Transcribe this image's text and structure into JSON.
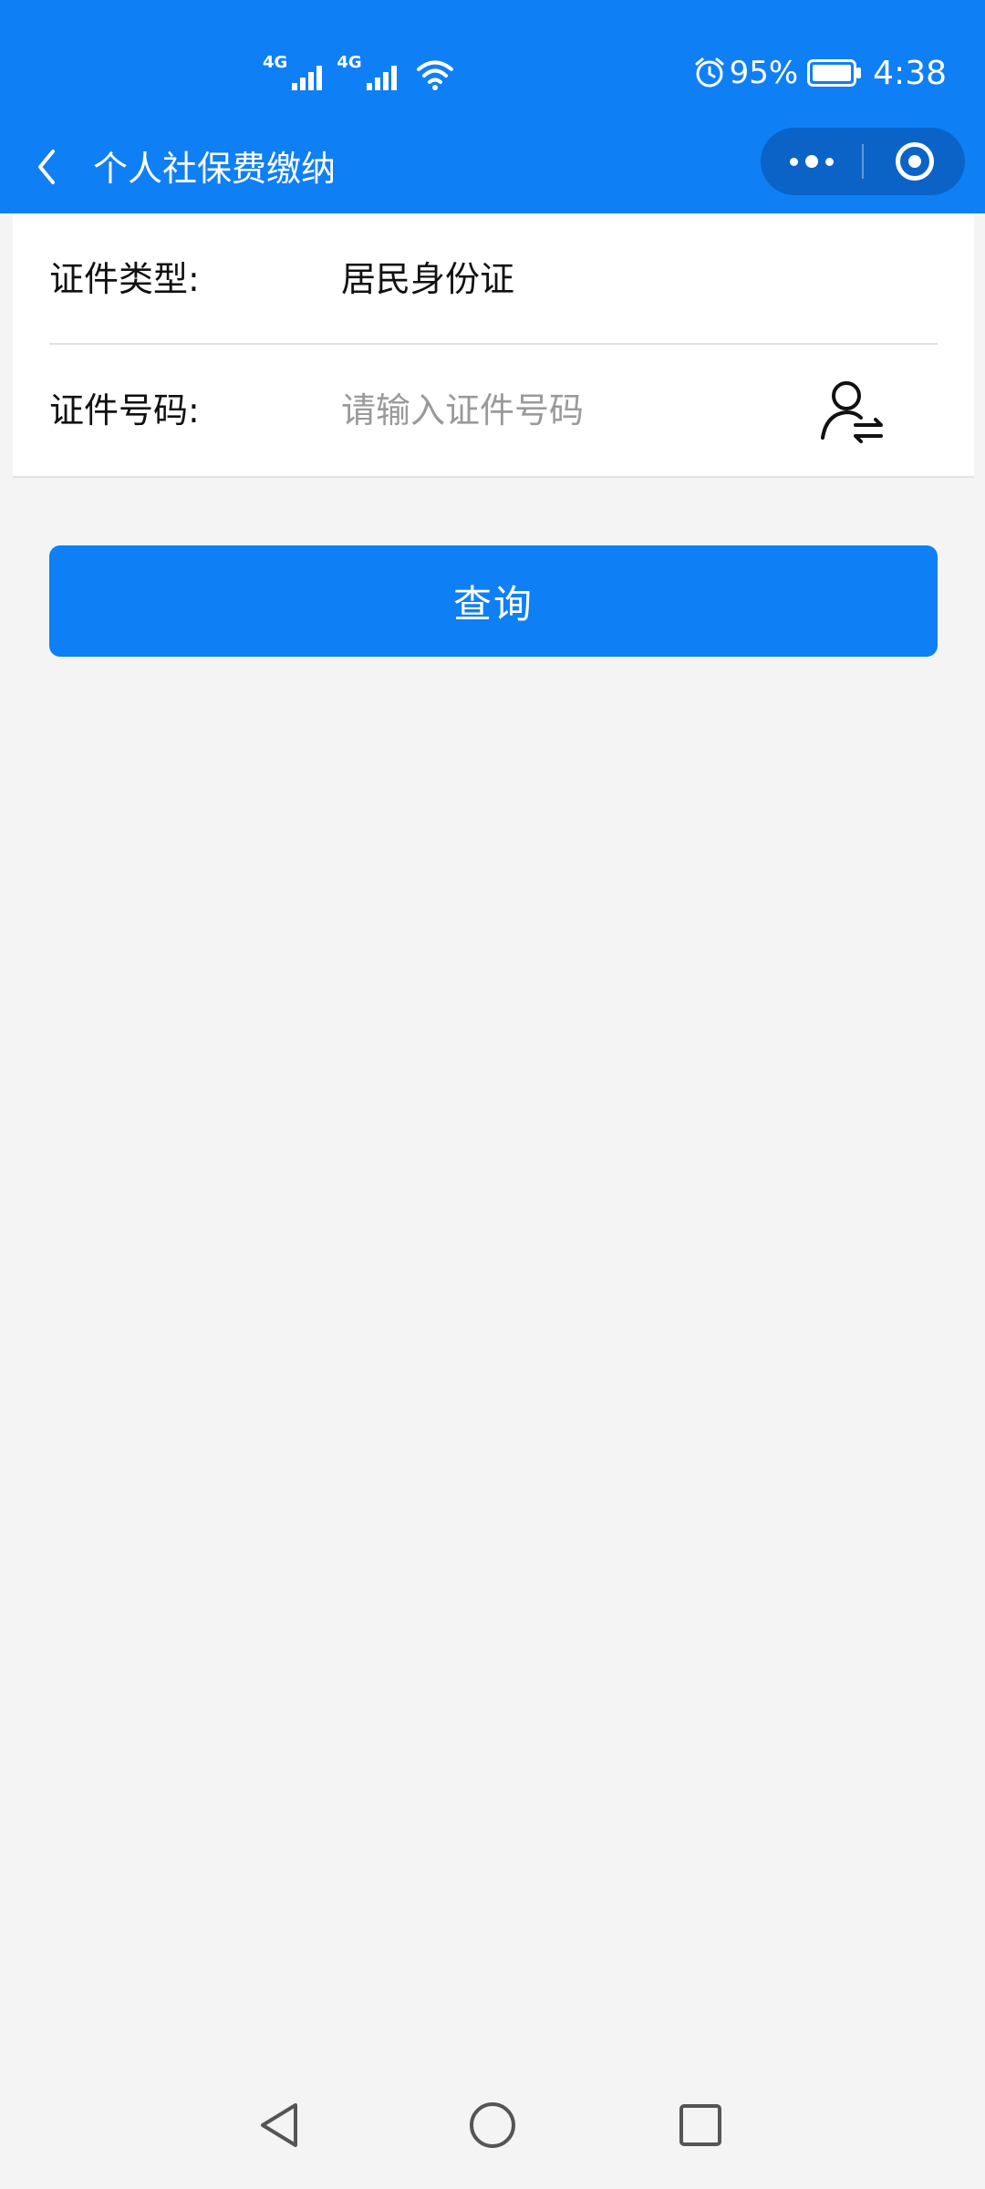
{
  "status_bar": {
    "network_1": "4G",
    "network_2": "4G",
    "battery_percent": "95%",
    "time": "4:38",
    "icons": [
      "signal-icon",
      "wifi-icon",
      "alarm-icon",
      "battery-icon"
    ]
  },
  "nav": {
    "title": "个人社保费缴纳",
    "back_icon": "chevron-left-icon",
    "more_icon": "more-dots-icon",
    "close_icon": "target-circle-icon"
  },
  "form": {
    "id_type_label": "证件类型:",
    "id_type_value": "居民身份证",
    "id_number_label": "证件号码:",
    "id_number_placeholder": "请输入证件号码",
    "id_number_value": "",
    "switch_icon": "person-swap-icon"
  },
  "actions": {
    "query_label": "查询"
  },
  "system_nav": {
    "back_icon": "triangle-back-icon",
    "home_icon": "circle-home-icon",
    "recent_icon": "square-recent-icon"
  },
  "colors": {
    "primary": "#0f7ff5",
    "capsule": "#0b63c8",
    "background": "#f4f4f4",
    "placeholder": "#9a9a9a"
  }
}
